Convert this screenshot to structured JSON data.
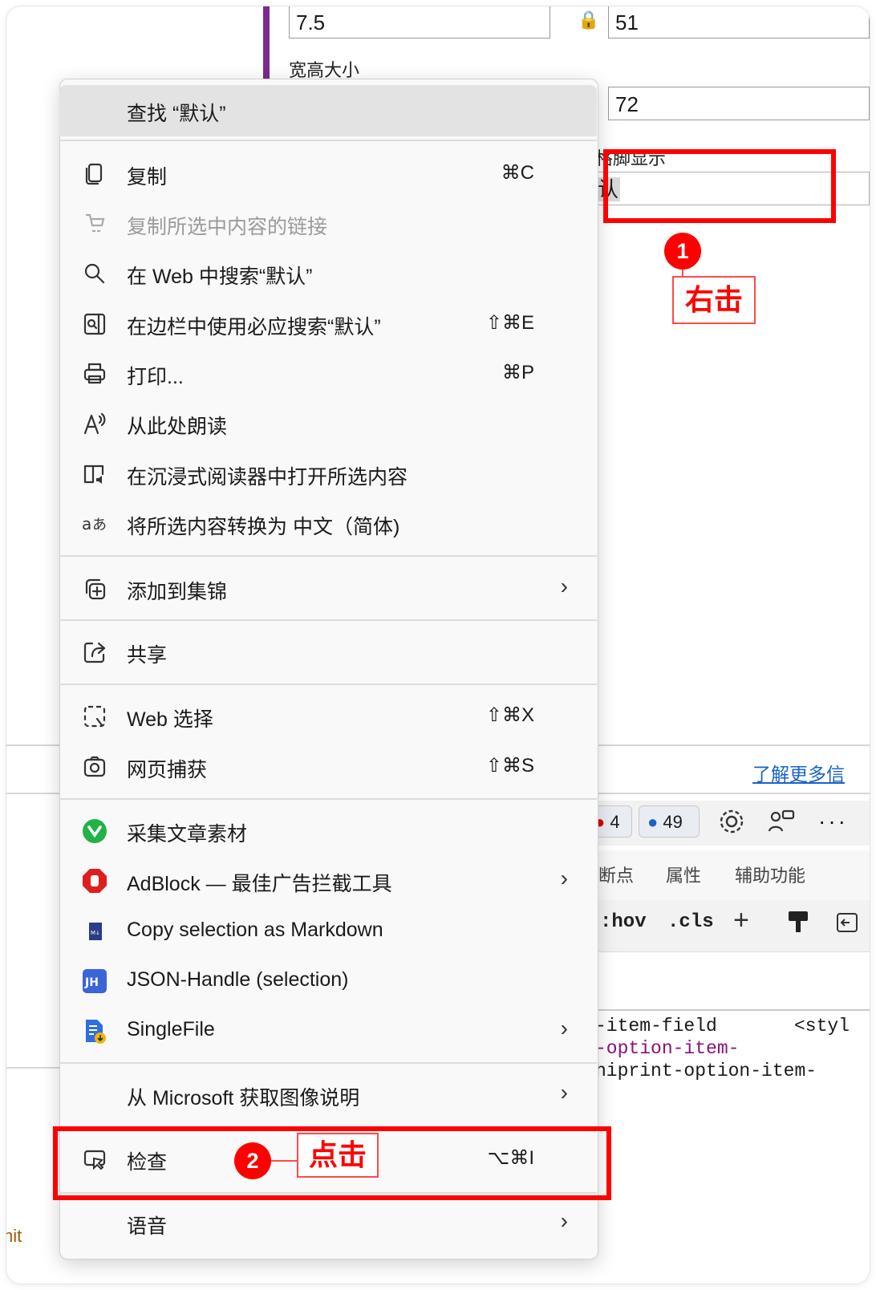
{
  "background": {
    "field_values": [
      "7.5",
      "51",
      "72"
    ],
    "label_width_height": "宽高大小",
    "label_footer_display": "表格脚显示",
    "footer_value": "默认",
    "learn_more": "了解更多信",
    "devtools": {
      "issue_count": "4",
      "message_count": "49",
      "tabs": [
        "断点",
        "属性",
        "辅助功能"
      ],
      "style_buttons": [
        ":hov",
        ".cls"
      ],
      "code_lines": [
        {
          "text": "-item-field",
          "color": "#222222"
        },
        {
          "text": "<styl",
          "color": "#222222"
        },
        {
          "text": "-option-item-",
          "color": "#881280"
        },
        {
          "text": "hiprint-option-item-",
          "color": "#222222"
        }
      ],
      "bottom_fragment": "nit"
    }
  },
  "context_menu": {
    "find": "查找 “默认”",
    "items": [
      {
        "icon": "copy-icon",
        "label": "复制",
        "shortcut": "⌘C",
        "disabled": false,
        "submenu": false
      },
      {
        "icon": "copy-link-icon",
        "label": "复制所选中内容的链接",
        "shortcut": "",
        "disabled": true,
        "submenu": false
      },
      {
        "icon": "search-icon",
        "label": "在 Web 中搜索“默认”",
        "shortcut": "",
        "disabled": false,
        "submenu": false
      },
      {
        "icon": "sidebar-search-icon",
        "label": "在边栏中使用必应搜索“默认”",
        "shortcut": "⇧⌘E",
        "disabled": false,
        "submenu": false
      },
      {
        "icon": "print-icon",
        "label": "打印...",
        "shortcut": "⌘P",
        "disabled": false,
        "submenu": false
      },
      {
        "icon": "read-aloud-icon",
        "label": "从此处朗读",
        "shortcut": "",
        "disabled": false,
        "submenu": false
      },
      {
        "icon": "immersive-reader-icon",
        "label": "在沉浸式阅读器中打开所选内容",
        "shortcut": "",
        "disabled": false,
        "submenu": false
      },
      {
        "icon": "translate-icon",
        "label": "将所选内容转换为 中文（简体)",
        "shortcut": "",
        "disabled": false,
        "submenu": false
      },
      {
        "icon": "collections-icon",
        "label": "添加到集锦",
        "shortcut": "",
        "disabled": false,
        "submenu": true
      },
      {
        "icon": "share-icon",
        "label": "共享",
        "shortcut": "",
        "disabled": false,
        "submenu": false
      },
      {
        "icon": "web-select-icon",
        "label": "Web 选择",
        "shortcut": "⇧⌘X",
        "disabled": false,
        "submenu": false
      },
      {
        "icon": "web-capture-icon",
        "label": "网页捕获",
        "shortcut": "⇧⌘S",
        "disabled": false,
        "submenu": false
      },
      {
        "icon": "article-collector-icon",
        "label": "采集文章素材",
        "shortcut": "",
        "disabled": false,
        "submenu": false
      },
      {
        "icon": "adblock-icon",
        "label": "AdBlock — 最佳广告拦截工具",
        "shortcut": "",
        "disabled": false,
        "submenu": true
      },
      {
        "icon": "markdown-icon",
        "label": "Copy selection as Markdown",
        "shortcut": "",
        "disabled": false,
        "submenu": false
      },
      {
        "icon": "json-handle-icon",
        "label": "JSON-Handle (selection)",
        "shortcut": "",
        "disabled": false,
        "submenu": false
      },
      {
        "icon": "singlefile-icon",
        "label": "SingleFile",
        "shortcut": "",
        "disabled": false,
        "submenu": true
      },
      {
        "icon": "",
        "label": "从 Microsoft 获取图像说明",
        "shortcut": "",
        "disabled": false,
        "submenu": true
      },
      {
        "icon": "inspect-icon",
        "label": "检查",
        "shortcut": "⌥⌘I",
        "disabled": false,
        "submenu": false
      },
      {
        "icon": "",
        "label": "语音",
        "shortcut": "",
        "disabled": false,
        "submenu": true
      }
    ],
    "icon_glyphs": {
      "json-handle-icon": "JH",
      "markdown-icon": "M↓"
    },
    "submenu_arrow": "›"
  },
  "annotations": {
    "step1_number": "1",
    "step1_label": "右击",
    "step2_number": "2",
    "step2_label": "点击",
    "color": "#ff0000"
  }
}
